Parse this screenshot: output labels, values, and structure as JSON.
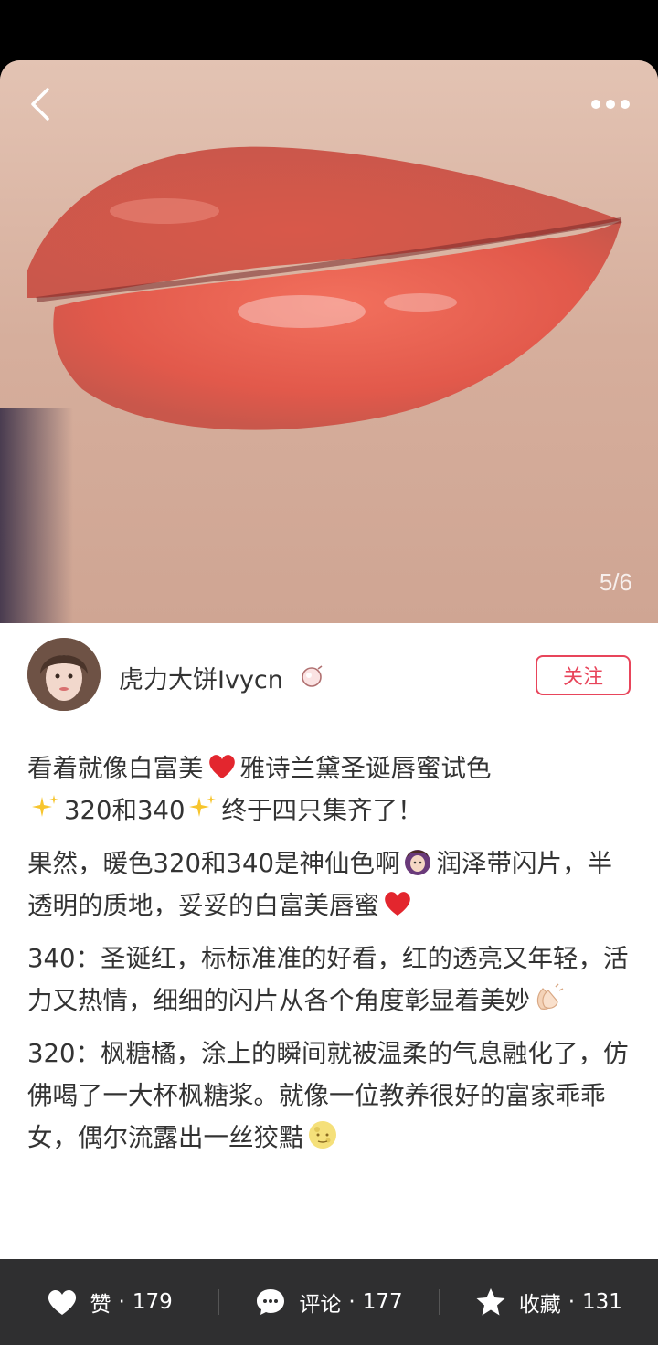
{
  "photo": {
    "page_indicator": "5/6"
  },
  "nav": {
    "back_icon": "chevron-left-icon",
    "more_icon": "more-dots-icon"
  },
  "author": {
    "name": "虎力大饼Ivycn",
    "follow_label": "关注"
  },
  "post": {
    "para1_a": "看着就像白富美",
    "para1_b": "雅诗兰黛圣诞唇蜜试色",
    "para1_c": "320和340",
    "para1_d": "终于四只集齐了！",
    "para2_a": "果然，暖色320和340是神仙色啊",
    "para2_b": "润泽带闪片，半透明的质地，妥妥的白富美唇蜜",
    "para3_a": "340：圣诞红，标标准准的好看，红的透亮又年轻，活力又热情，细细的闪片从各个角度彰显着美妙",
    "para4_a": "320：枫糖橘，涂上的瞬间就被温柔的气息融化了，仿佛喝了一大杯枫糖浆。就像一位教养很好的富家乖乖女，偶尔流露出一丝狡黠"
  },
  "actions": {
    "like_label": "赞",
    "like_count": "179",
    "comment_label": "评论",
    "comment_count": "177",
    "collect_label": "收藏",
    "collect_count": "131",
    "dot": "·"
  },
  "colors": {
    "accent": "#e8455b",
    "bottom_bar": "#2f2f30",
    "text": "#333333"
  }
}
